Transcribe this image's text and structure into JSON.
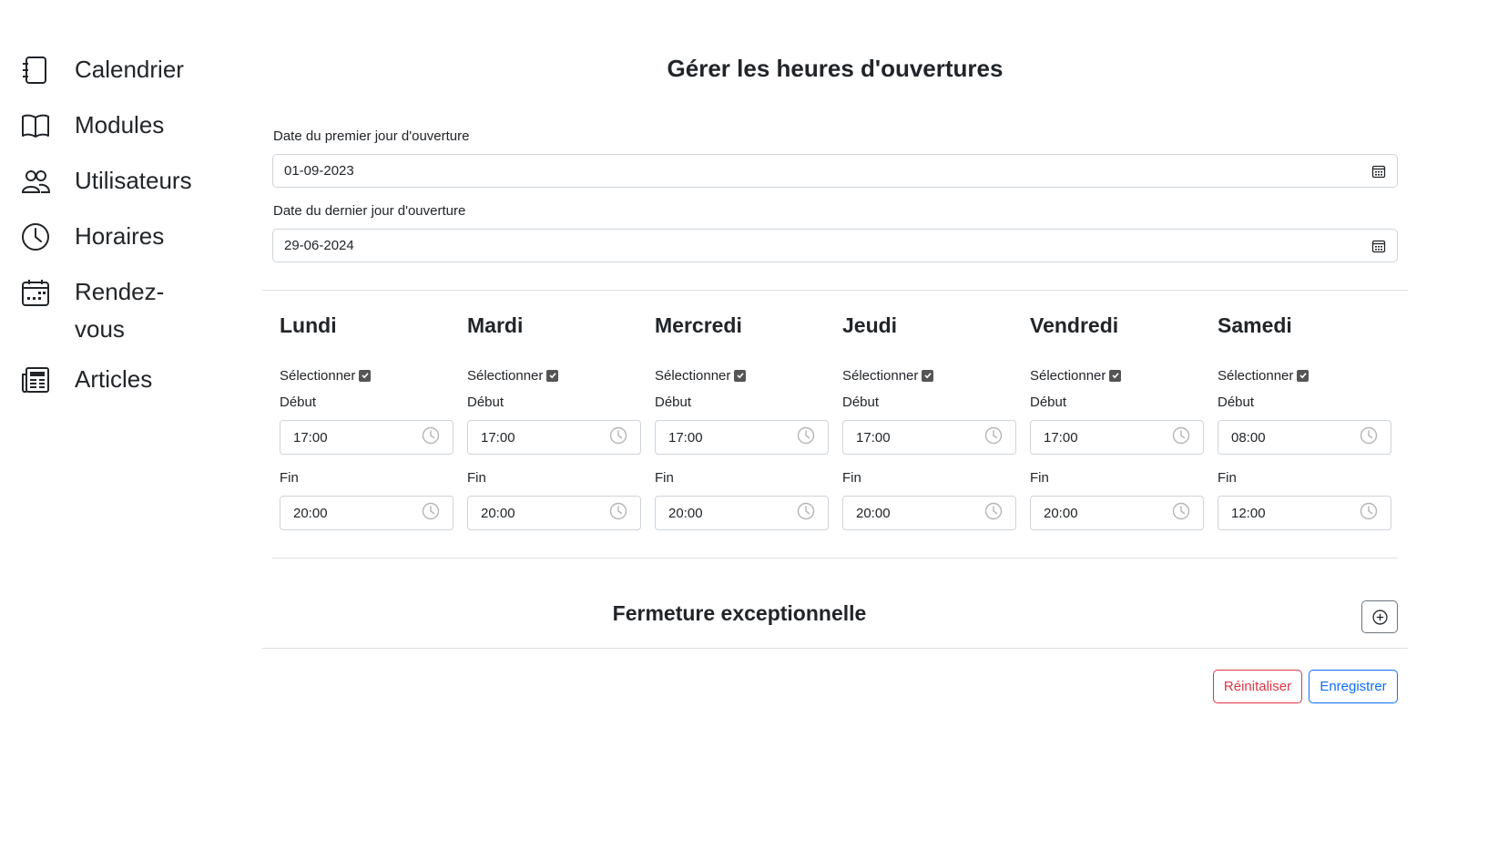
{
  "sidebar": {
    "items": [
      {
        "label": "Calendrier",
        "icon": "journal-icon"
      },
      {
        "label": "Modules",
        "icon": "book-icon"
      },
      {
        "label": "Utilisateurs",
        "icon": "people-icon"
      },
      {
        "label": "Horaires",
        "icon": "clock-icon"
      },
      {
        "label": "Rendez-vous",
        "icon": "calendar-week-icon"
      },
      {
        "label": "Articles",
        "icon": "newspaper-icon"
      }
    ]
  },
  "main": {
    "title": "Gérer les heures d'ouvertures",
    "first_day_label": "Date du premier jour d'ouverture",
    "first_day_value": "01-09-2023",
    "last_day_label": "Date du dernier jour d'ouverture",
    "last_day_value": "29-06-2024",
    "select_label": "Sélectionner",
    "start_label": "Début",
    "end_label": "Fin",
    "days": [
      {
        "name": "Lundi",
        "selected": true,
        "start": "17:00",
        "end": "20:00"
      },
      {
        "name": "Mardi",
        "selected": true,
        "start": "17:00",
        "end": "20:00"
      },
      {
        "name": "Mercredi",
        "selected": true,
        "start": "17:00",
        "end": "20:00"
      },
      {
        "name": "Jeudi",
        "selected": true,
        "start": "17:00",
        "end": "20:00"
      },
      {
        "name": "Vendredi",
        "selected": true,
        "start": "17:00",
        "end": "20:00"
      },
      {
        "name": "Samedi",
        "selected": true,
        "start": "08:00",
        "end": "12:00"
      }
    ],
    "exceptional_closure_title": "Fermeture exceptionnelle",
    "reset_label": "Réinitaliser",
    "save_label": "Enregistrer"
  },
  "colors": {
    "danger": "#dc3545",
    "primary": "#0d6efd",
    "border": "#ced4da"
  }
}
